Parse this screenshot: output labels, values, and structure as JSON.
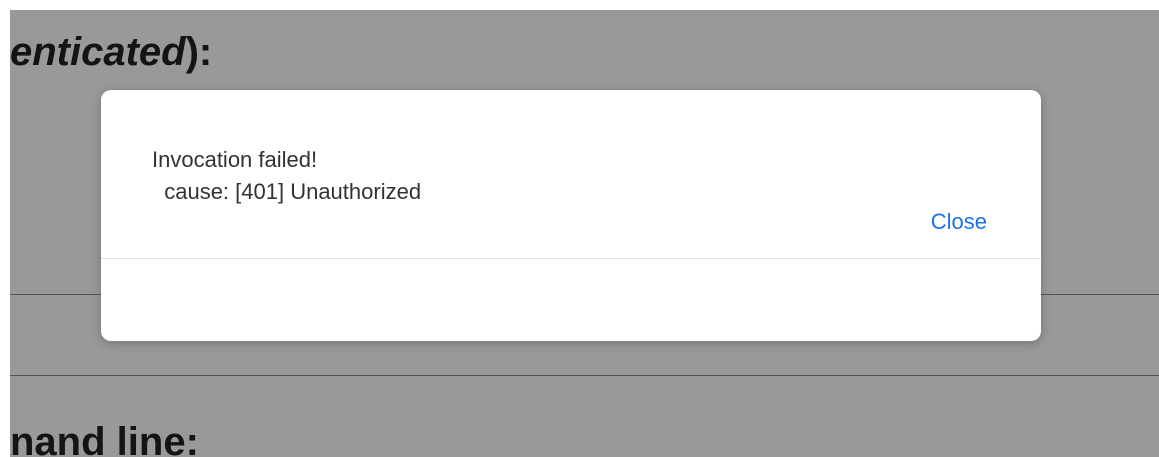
{
  "page": {
    "heading_top_italic": "enticated",
    "heading_top_suffix": "):",
    "heading_bottom": "nand line:"
  },
  "dialog": {
    "message": "Invocation failed!\n  cause: [401] Unauthorized",
    "close_label": "Close"
  },
  "colors": {
    "accent": "#1a73e8",
    "backdrop": "#9a9a9a",
    "dialog_bg": "#ffffff",
    "text": "#333333"
  }
}
